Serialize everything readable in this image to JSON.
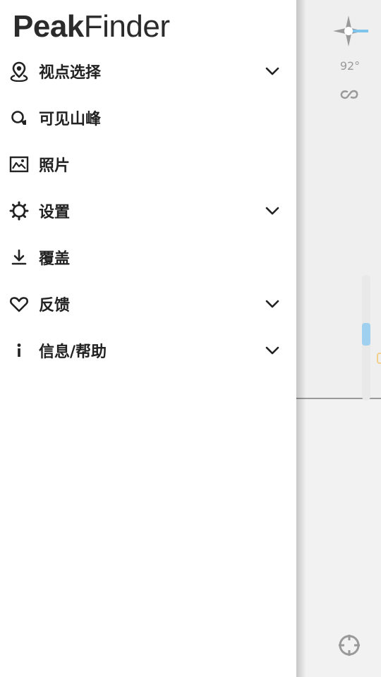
{
  "app": {
    "logo_bold": "Peak",
    "logo_light": "Finder"
  },
  "menu": {
    "items": [
      {
        "label": "视点选择",
        "icon": "location-pin-icon",
        "expandable": true
      },
      {
        "label": "可见山峰",
        "icon": "search-peak-icon",
        "expandable": false
      },
      {
        "label": "照片",
        "icon": "photo-icon",
        "expandable": false
      },
      {
        "label": "设置",
        "icon": "gear-icon",
        "expandable": true
      },
      {
        "label": "覆盖",
        "icon": "download-icon",
        "expandable": false
      },
      {
        "label": "反馈",
        "icon": "heart-icon",
        "expandable": true
      },
      {
        "label": "信息/帮助",
        "icon": "info-icon",
        "expandable": true
      }
    ]
  },
  "map": {
    "heading": "92°",
    "zoom_level_fraction": 0.35
  },
  "colors": {
    "drawer_background": "#ffffff",
    "text": "#222222",
    "map_icon": "#9a9a9a",
    "zoom_thumb": "#9fd0ef",
    "compass_needle": "#7fc4ec"
  }
}
